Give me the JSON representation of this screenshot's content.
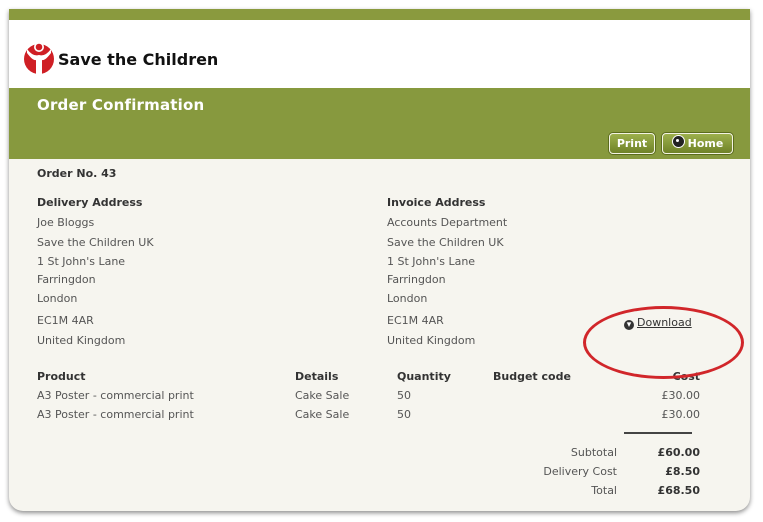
{
  "brand": {
    "name": "Save the Children"
  },
  "header": {
    "title": "Order Confirmation"
  },
  "toolbar": {
    "print_label": "Print",
    "home_label": "Home"
  },
  "order": {
    "number_label": "Order No. 43"
  },
  "delivery": {
    "heading": "Delivery Address",
    "lines": [
      "Joe Bloggs",
      "Save the Children UK",
      "1 St John's Lane",
      "Farringdon",
      "London",
      "EC1M 4AR",
      "United Kingdom"
    ]
  },
  "invoice": {
    "heading": "Invoice Address",
    "lines": [
      "Accounts Department",
      "Save the Children UK",
      "1 St John's Lane",
      "Farringdon",
      "London",
      "EC1M 4AR",
      "United Kingdom"
    ]
  },
  "download": {
    "label": "Download"
  },
  "table": {
    "headers": [
      "Product",
      "Details",
      "Quantity",
      "Budget code",
      "Cost"
    ],
    "rows": [
      [
        "A3 Poster - commercial print",
        "Cake Sale",
        "50",
        "",
        "£30.00"
      ],
      [
        "A3 Poster - commercial print",
        "Cake Sale",
        "50",
        "",
        "£30.00"
      ]
    ]
  },
  "totals": {
    "subtotal_label": "Subtotal",
    "subtotal_value": "£60.00",
    "delivery_label": "Delivery Cost",
    "delivery_value": "£8.50",
    "total_label": "Total",
    "total_value": "£68.50"
  },
  "colors": {
    "brand_green": "#87993e",
    "logo_red": "#cf1f25",
    "highlight_red": "#d1262a"
  },
  "icons": {
    "logo": "save-the-children-logo-icon",
    "home": "home-icon",
    "download": "download-icon"
  }
}
